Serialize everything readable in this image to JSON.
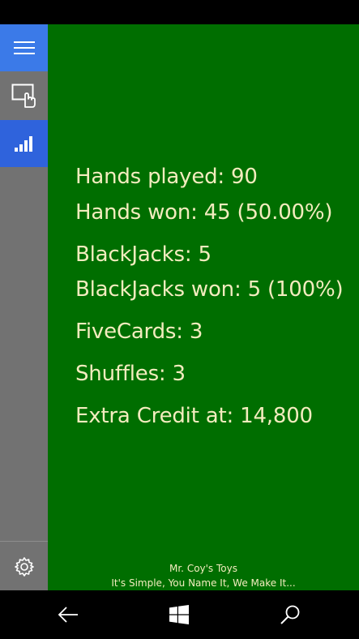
{
  "sidebar": {
    "items": [
      {
        "icon": "hamburger-menu-icon"
      },
      {
        "icon": "touch-screen-icon"
      },
      {
        "icon": "stats-bars-icon"
      },
      {
        "icon": "gear-icon"
      }
    ],
    "accent_color": "#3b7ae8",
    "selected_color": "#2f63dc"
  },
  "stats": {
    "hands_played": "Hands played: 90",
    "hands_won": "Hands won: 45 (50.00%)",
    "blackjacks": "BlackJacks: 5",
    "blackjacks_won": "BlackJacks won: 5 (100%)",
    "fivecards": "FiveCards: 3",
    "shuffles": "Shuffles: 3",
    "extra_credit": "Extra Credit at: 14,800"
  },
  "footer": {
    "company": "Mr. Coy's Toys",
    "slogan": "It's Simple, You Name It, We Make It..."
  },
  "navbar": {
    "items": [
      {
        "icon": "back-arrow-icon"
      },
      {
        "icon": "windows-logo-icon"
      },
      {
        "icon": "search-icon"
      }
    ]
  },
  "colors": {
    "felt_green": "#006e00",
    "text_cream": "#f3ecbe",
    "sidebar_gray": "#727272"
  }
}
